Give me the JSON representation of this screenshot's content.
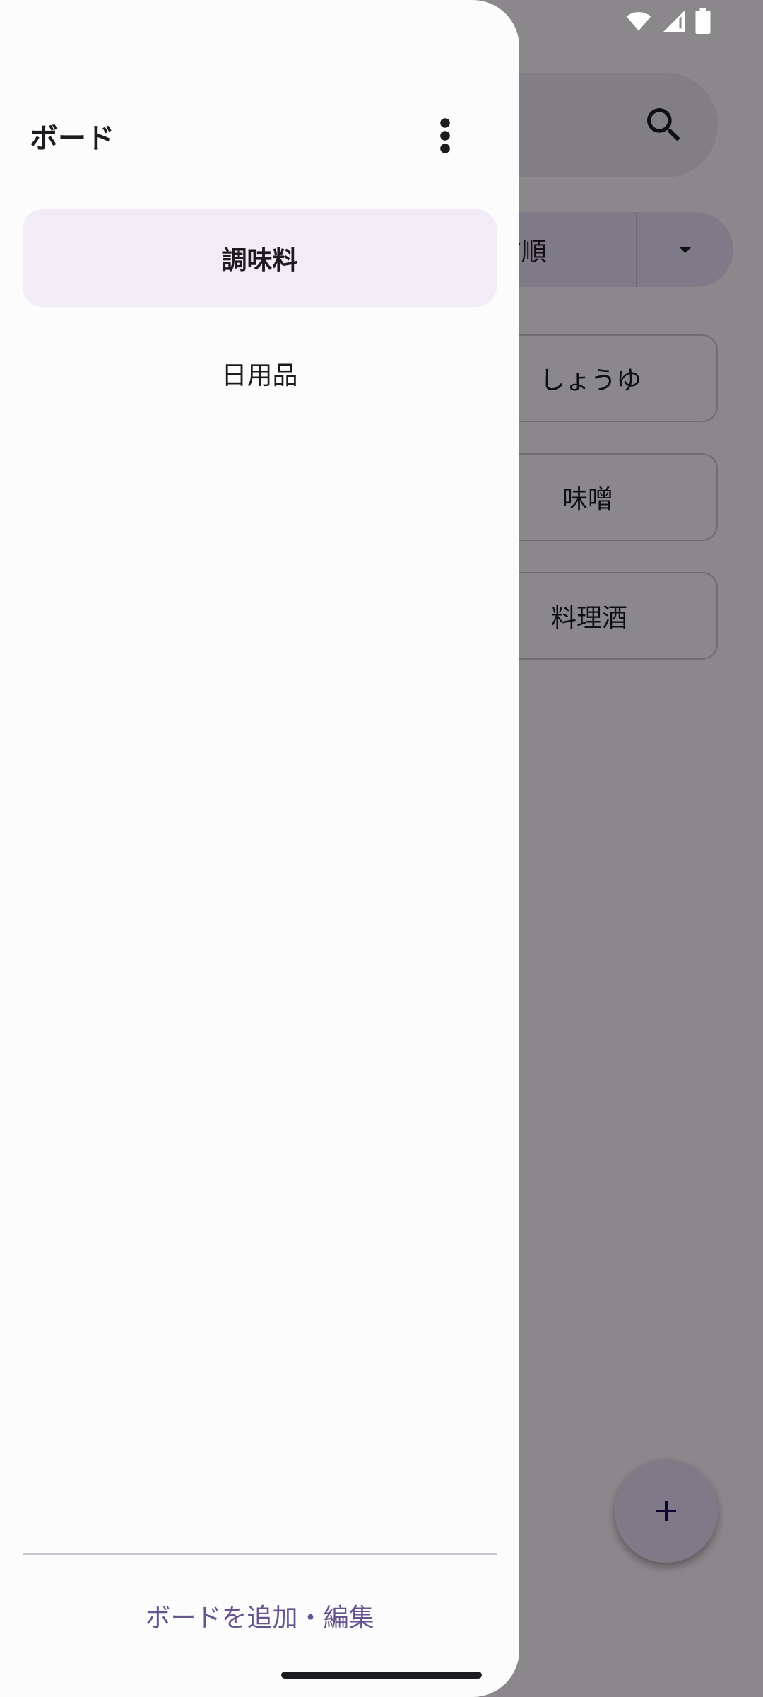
{
  "status_bar": {
    "icons": [
      "wifi-icon",
      "cellular-signal-icon",
      "battery-icon"
    ]
  },
  "background_app": {
    "search_icon": "search-icon",
    "sort": {
      "selected_label": "名前順",
      "dropdown_icon": "arrow-drop-down-icon"
    },
    "items": [
      {
        "label": "しょうゆ"
      },
      {
        "label": "味噌"
      },
      {
        "label": "料理酒"
      }
    ],
    "fab_icon": "add-icon"
  },
  "drawer": {
    "title": "ボード",
    "more_icon": "more-vertical-icon",
    "boards": [
      {
        "label": "調味料",
        "selected": true
      },
      {
        "label": "日用品",
        "selected": false
      }
    ],
    "footer_action": "ボードを追加・編集"
  },
  "colors": {
    "accent": "#65558f",
    "selected_item_bg": "#f1ecf5",
    "surface": "#fdfcfd",
    "scrim": "rgba(0,0,0,0.45)"
  }
}
